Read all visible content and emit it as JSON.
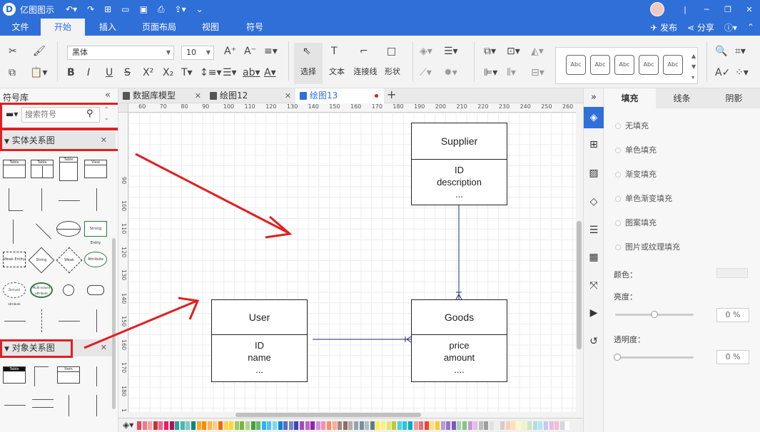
{
  "app": {
    "title": "亿图图示"
  },
  "menu": {
    "tabs": [
      "文件",
      "开始",
      "插入",
      "页面布局",
      "视图",
      "符号"
    ],
    "active": 1,
    "publish": "发布",
    "share": "分享"
  },
  "ribbon": {
    "font_name": "黑体",
    "font_size": "10",
    "select_label": "选择",
    "text_label": "文本",
    "connector_label": "连接线",
    "shape_label": "形状",
    "style_samples": [
      "Abc",
      "Abc",
      "Abc",
      "Abc",
      "Abc"
    ]
  },
  "library": {
    "title": "符号库",
    "search_placeholder": "搜索符号",
    "categories": [
      {
        "name": "实体关系图",
        "items": [
          "Table",
          "Table",
          "Table",
          "View",
          "",
          "",
          "",
          "",
          "",
          "",
          "",
          "Strong Entity",
          "Weak Entity",
          "String",
          "Weak",
          "Attribute",
          "Derived attribute",
          "Multi-valued attribute",
          "",
          ""
        ]
      },
      {
        "name": "对象关系图",
        "items": [
          "Table",
          "",
          "Item",
          ""
        ]
      }
    ]
  },
  "documents": {
    "tabs": [
      "数据库模型",
      "绘图12",
      "绘图13"
    ],
    "active": 2
  },
  "ruler": {
    "h_ticks": [
      "60",
      "70",
      "80",
      "90",
      "100",
      "110",
      "120",
      "130",
      "140",
      "150",
      "160",
      "170",
      "180",
      "190",
      "200",
      "210",
      "220",
      "230",
      "240",
      "250",
      "260"
    ],
    "v_ticks": [
      "90",
      "100",
      "110",
      "120",
      "130",
      "140",
      "150",
      "160",
      "170",
      "180",
      "190"
    ]
  },
  "diagram": {
    "entities": [
      {
        "id": "supplier",
        "name": "Supplier",
        "attributes": [
          "ID",
          "description",
          "..."
        ]
      },
      {
        "id": "user",
        "name": "User",
        "attributes": [
          "ID",
          "name",
          "..."
        ]
      },
      {
        "id": "goods",
        "name": "Goods",
        "attributes": [
          "price",
          "amount",
          "...."
        ]
      }
    ]
  },
  "right_panel": {
    "tabs": [
      "填充",
      "线条",
      "阴影"
    ],
    "active": 0,
    "fill_options": [
      "无填充",
      "单色填充",
      "渐变填充",
      "单色渐变填充",
      "图案填充",
      "图片或纹理填充"
    ],
    "color_label": "颜色：",
    "brightness_label": "亮度：",
    "brightness_value": "0 %",
    "transparency_label": "透明度：",
    "transparency_value": "0 %"
  },
  "colors": {
    "accent": "#2f6fd8",
    "annotation": "#e02020"
  }
}
